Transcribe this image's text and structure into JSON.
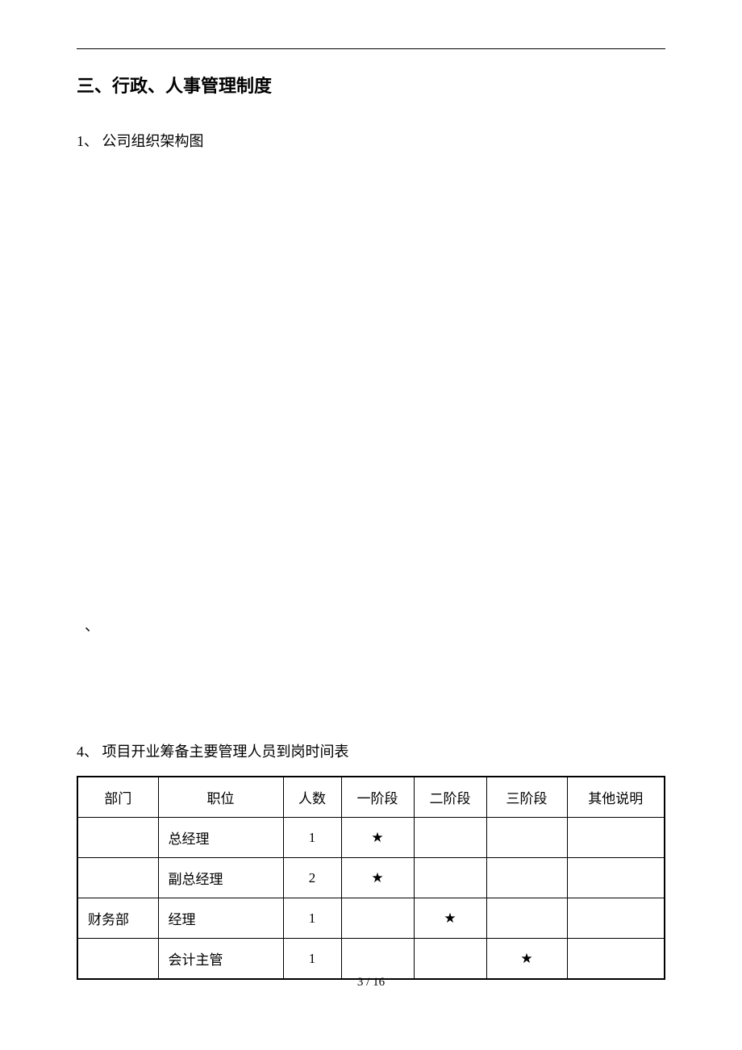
{
  "heading": "三、行政、人事管理制度",
  "section1_title": "1、 公司组织架构图",
  "backtick_text": "、",
  "section4_title": "4、 项目开业筹备主要管理人员到岗时间表",
  "table": {
    "headers": [
      "部门",
      "职位",
      "人数",
      "一阶段",
      "二阶段",
      "三阶段",
      "其他说明"
    ],
    "rows": [
      {
        "dept": "",
        "position": "总经理",
        "count": "1",
        "phase1": "★",
        "phase2": "",
        "phase3": "",
        "other": ""
      },
      {
        "dept": "",
        "position": "副总经理",
        "count": "2",
        "phase1": "★",
        "phase2": "",
        "phase3": "",
        "other": ""
      },
      {
        "dept": "财务部",
        "position": "经理",
        "count": "1",
        "phase1": "",
        "phase2": "★",
        "phase3": "",
        "other": ""
      },
      {
        "dept": "",
        "position": "会计主管",
        "count": "1",
        "phase1": "",
        "phase2": "",
        "phase3": "★",
        "other": ""
      }
    ]
  },
  "page_number": "3 / 16"
}
